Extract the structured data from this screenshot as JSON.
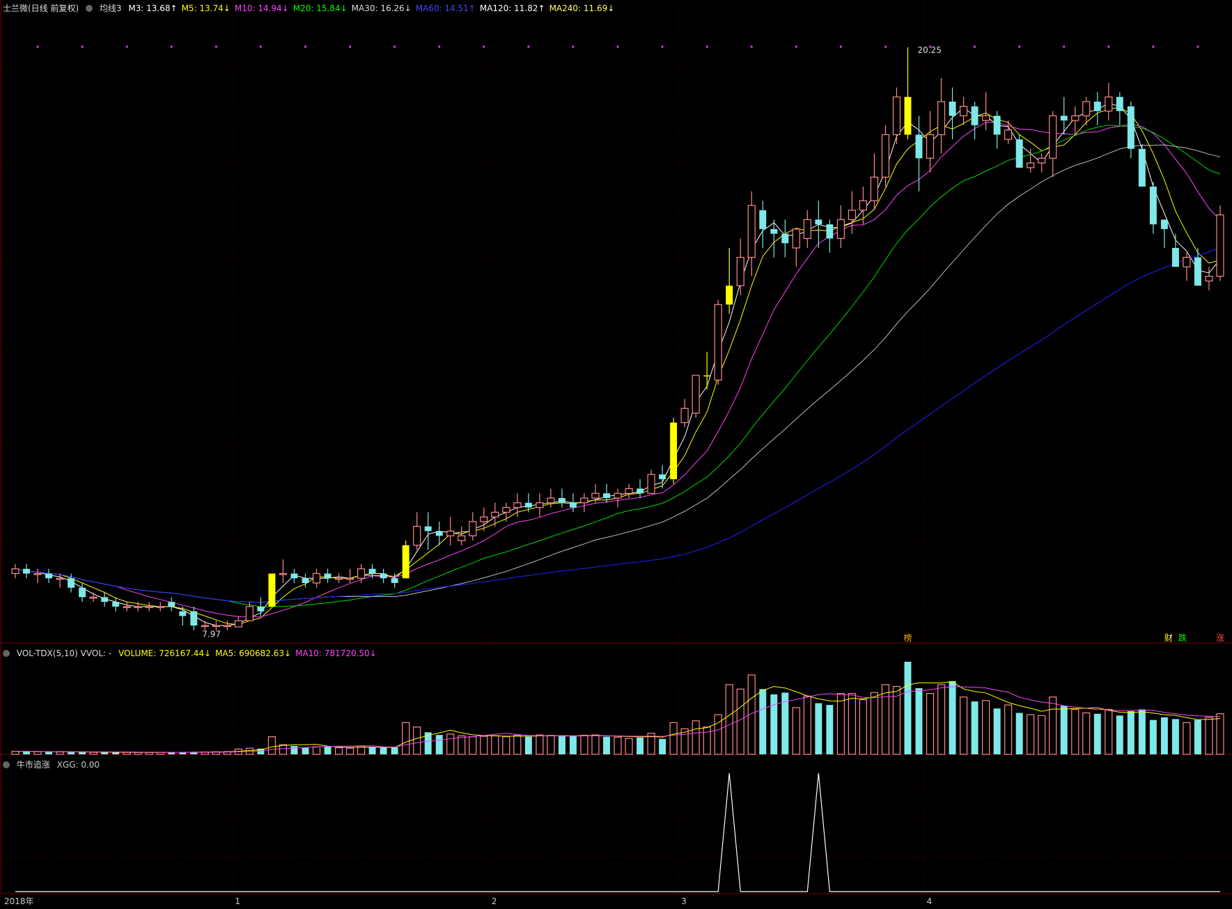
{
  "header_main": {
    "stock_name": "士兰微(日线 前复权)",
    "ma_label": "均线3",
    "items": [
      {
        "text": "M3: 13.68",
        "color": "#ffffff",
        "arrow": "↑"
      },
      {
        "text": "M5: 13.74",
        "color": "#ffff00",
        "arrow": "↓"
      },
      {
        "text": "M10: 14.94",
        "color": "#ff44ff",
        "arrow": "↓"
      },
      {
        "text": "M20: 15.84",
        "color": "#00ff00",
        "arrow": "↓"
      },
      {
        "text": "MA30: 16.26",
        "color": "#dddddd",
        "arrow": "↓"
      },
      {
        "text": "MA60: 14.51",
        "color": "#4444ff",
        "arrow": "↑"
      },
      {
        "text": "MA120: 11.82",
        "color": "#ffffff",
        "arrow": "↑"
      },
      {
        "text": "MA240: 11.69",
        "color": "#ffff66",
        "arrow": "↓"
      }
    ]
  },
  "header_vol": {
    "label": "VOL-TDX(5,10) VVOL: -",
    "items": [
      {
        "text": "VOLUME: 726167.44",
        "color": "#ffff00",
        "arrow": "↓"
      },
      {
        "text": "MA5: 690682.63",
        "color": "#ffff00",
        "arrow": "↓"
      },
      {
        "text": "MA10: 781720.50",
        "color": "#ff44ff",
        "arrow": "↓"
      }
    ]
  },
  "header_ind": {
    "label": "牛市追涨",
    "items": [
      {
        "text": "XGG: 0.00",
        "color": "#cccccc",
        "arrow": ""
      }
    ]
  },
  "annotations": {
    "high": "20.25",
    "low": "7.97",
    "tag1": "榜",
    "tag2": "财",
    "tag3": "跌",
    "tag4": "涨"
  },
  "x_labels": [
    "2018年",
    "1",
    "2",
    "3",
    "4"
  ],
  "colors": {
    "up": "#ff8a8a",
    "down": "#7fe8e8",
    "highlight": "#ffff00",
    "grid": "#7a0000"
  },
  "chart_data": {
    "type": "candlestick",
    "candles": [
      [
        9.1,
        9.3,
        9.2,
        9.0
      ],
      [
        9.2,
        9.3,
        9.1,
        9.0
      ],
      [
        9.1,
        9.2,
        9.1,
        8.9
      ],
      [
        9.1,
        9.2,
        9.0,
        8.9
      ],
      [
        9.0,
        9.1,
        9.0,
        8.8
      ],
      [
        9.0,
        9.1,
        8.8,
        8.7
      ],
      [
        8.8,
        8.9,
        8.6,
        8.5
      ],
      [
        8.6,
        8.7,
        8.6,
        8.5
      ],
      [
        8.6,
        8.7,
        8.5,
        8.4
      ],
      [
        8.5,
        8.6,
        8.4,
        8.3
      ],
      [
        8.4,
        8.5,
        8.4,
        8.3
      ],
      [
        8.4,
        8.5,
        8.4,
        8.3
      ],
      [
        8.4,
        8.5,
        8.4,
        8.3
      ],
      [
        8.4,
        8.5,
        8.4,
        8.3
      ],
      [
        8.5,
        8.6,
        8.4,
        8.3
      ],
      [
        8.3,
        8.4,
        8.2,
        8.0
      ],
      [
        8.3,
        8.4,
        8.0,
        7.9
      ],
      [
        8.0,
        8.1,
        8.0,
        7.9
      ],
      [
        8.0,
        8.1,
        8.0,
        7.9
      ],
      [
        8.0,
        8.1,
        8.0,
        7.9
      ],
      [
        7.97,
        8.2,
        8.1,
        7.97
      ],
      [
        8.1,
        8.5,
        8.4,
        8.1
      ],
      [
        8.4,
        8.6,
        8.3,
        8.2
      ],
      [
        8.4,
        9.1,
        9.1,
        8.4
      ],
      [
        9.1,
        9.4,
        9.1,
        8.9
      ],
      [
        9.1,
        9.2,
        9.0,
        8.9
      ],
      [
        9.0,
        9.1,
        8.9,
        8.8
      ],
      [
        8.9,
        9.2,
        9.1,
        8.8
      ],
      [
        9.1,
        9.2,
        9.0,
        8.9
      ],
      [
        9.0,
        9.1,
        9.0,
        8.9
      ],
      [
        9.0,
        9.2,
        9.0,
        8.9
      ],
      [
        9.0,
        9.3,
        9.2,
        8.9
      ],
      [
        9.2,
        9.3,
        9.1,
        9.0
      ],
      [
        9.1,
        9.2,
        9.0,
        8.9
      ],
      [
        9.0,
        9.1,
        8.9,
        8.8
      ],
      [
        9.0,
        9.8,
        9.7,
        9.0
      ],
      [
        9.7,
        10.4,
        10.1,
        9.6
      ],
      [
        10.1,
        10.4,
        10.0,
        9.6
      ],
      [
        10.0,
        10.2,
        9.9,
        9.7
      ],
      [
        9.9,
        10.3,
        10.0,
        9.7
      ],
      [
        9.8,
        10.1,
        9.9,
        9.7
      ],
      [
        9.9,
        10.4,
        10.2,
        9.8
      ],
      [
        10.2,
        10.5,
        10.3,
        10.0
      ],
      [
        10.3,
        10.6,
        10.4,
        10.1
      ],
      [
        10.4,
        10.6,
        10.5,
        10.2
      ],
      [
        10.5,
        10.8,
        10.6,
        10.3
      ],
      [
        10.6,
        10.8,
        10.5,
        10.4
      ],
      [
        10.5,
        10.8,
        10.6,
        10.3
      ],
      [
        10.6,
        10.9,
        10.7,
        10.5
      ],
      [
        10.7,
        10.9,
        10.6,
        10.5
      ],
      [
        10.6,
        10.8,
        10.5,
        10.4
      ],
      [
        10.6,
        10.8,
        10.7,
        10.4
      ],
      [
        10.7,
        11.0,
        10.8,
        10.6
      ],
      [
        10.8,
        11.0,
        10.7,
        10.6
      ],
      [
        10.7,
        10.9,
        10.8,
        10.5
      ],
      [
        10.8,
        11.0,
        10.9,
        10.7
      ],
      [
        10.9,
        11.1,
        10.8,
        10.7
      ],
      [
        10.8,
        11.3,
        11.2,
        10.8
      ],
      [
        11.2,
        11.4,
        11.1,
        10.9
      ],
      [
        11.1,
        12.4,
        12.3,
        11.0
      ],
      [
        12.3,
        12.8,
        12.6,
        12.2
      ],
      [
        12.5,
        13.3,
        13.3,
        12.4
      ],
      [
        13.3,
        13.8,
        13.3,
        13.0
      ],
      [
        13.2,
        14.9,
        14.8,
        13.1
      ],
      [
        14.8,
        16.0,
        15.2,
        14.6
      ],
      [
        15.2,
        16.2,
        15.8,
        15.0
      ],
      [
        15.8,
        17.2,
        16.9,
        15.4
      ],
      [
        16.8,
        17.0,
        16.4,
        16.0
      ],
      [
        16.4,
        16.6,
        16.3,
        15.8
      ],
      [
        16.3,
        16.6,
        16.1,
        15.8
      ],
      [
        16.0,
        16.4,
        16.4,
        15.6
      ],
      [
        16.2,
        16.8,
        16.6,
        16.0
      ],
      [
        16.6,
        17.0,
        16.5,
        16.0
      ],
      [
        16.5,
        16.6,
        16.2,
        15.9
      ],
      [
        16.2,
        16.9,
        16.6,
        16.0
      ],
      [
        16.6,
        17.2,
        16.8,
        16.3
      ],
      [
        16.8,
        17.3,
        17.0,
        16.5
      ],
      [
        17.0,
        18.0,
        17.5,
        16.8
      ],
      [
        17.5,
        18.6,
        18.4,
        17.3
      ],
      [
        18.4,
        19.4,
        19.2,
        18.2
      ],
      [
        19.2,
        20.25,
        18.4,
        18.3
      ],
      [
        18.4,
        18.8,
        17.9,
        17.2
      ],
      [
        17.9,
        18.9,
        18.4,
        17.6
      ],
      [
        18.4,
        19.6,
        19.1,
        18.0
      ],
      [
        19.1,
        19.4,
        18.8,
        18.3
      ],
      [
        18.8,
        19.2,
        19.0,
        18.6
      ],
      [
        19.0,
        19.1,
        18.6,
        18.3
      ],
      [
        18.7,
        19.3,
        18.8,
        18.5
      ],
      [
        18.8,
        18.9,
        18.4,
        18.1
      ],
      [
        18.3,
        18.7,
        18.5,
        18.2
      ],
      [
        18.3,
        18.4,
        17.7,
        17.7
      ],
      [
        17.7,
        18.1,
        17.8,
        17.6
      ],
      [
        17.8,
        18.0,
        17.9,
        17.6
      ],
      [
        17.9,
        18.9,
        18.8,
        17.5
      ],
      [
        18.8,
        19.2,
        18.7,
        18.4
      ],
      [
        18.7,
        19.0,
        18.8,
        18.4
      ],
      [
        18.8,
        19.2,
        19.1,
        18.6
      ],
      [
        19.1,
        19.3,
        18.9,
        18.6
      ],
      [
        18.9,
        19.5,
        19.2,
        18.7
      ],
      [
        19.2,
        19.3,
        18.9,
        18.6
      ],
      [
        19.0,
        19.1,
        18.1,
        17.9
      ],
      [
        18.1,
        18.2,
        17.3,
        17.4
      ],
      [
        17.3,
        17.4,
        16.5,
        16.3
      ],
      [
        16.6,
        16.6,
        16.4,
        16.0
      ],
      [
        16.0,
        16.3,
        15.6,
        15.6
      ],
      [
        15.6,
        15.9,
        15.8,
        15.3
      ],
      [
        15.8,
        16.0,
        15.2,
        15.2
      ],
      [
        15.3,
        15.6,
        15.4,
        15.1
      ],
      [
        15.4,
        16.9,
        16.7,
        15.3
      ]
    ],
    "highlights": [
      23,
      35,
      59,
      62,
      64,
      80,
      111
    ],
    "volume": [
      35,
      33,
      30,
      28,
      27,
      26,
      25,
      24,
      25,
      24,
      23,
      22,
      22,
      23,
      24,
      26,
      28,
      27,
      29,
      31,
      60,
      70,
      65,
      200,
      110,
      95,
      80,
      85,
      90,
      75,
      70,
      95,
      80,
      75,
      80,
      360,
      310,
      250,
      220,
      230,
      210,
      200,
      205,
      210,
      200,
      215,
      200,
      220,
      215,
      210,
      205,
      215,
      220,
      200,
      195,
      180,
      190,
      240,
      175,
      360,
      290,
      380,
      310,
      450,
      790,
      740,
      900,
      740,
      680,
      700,
      530,
      660,
      580,
      560,
      690,
      690,
      620,
      700,
      790,
      770,
      1050,
      750,
      690,
      790,
      830,
      650,
      600,
      610,
      520,
      560,
      470,
      450,
      440,
      650,
      550,
      510,
      470,
      460,
      510,
      440,
      490,
      510,
      390,
      420,
      400,
      360,
      390,
      420,
      460
    ],
    "xgg_peaks": [
      64,
      72
    ]
  }
}
